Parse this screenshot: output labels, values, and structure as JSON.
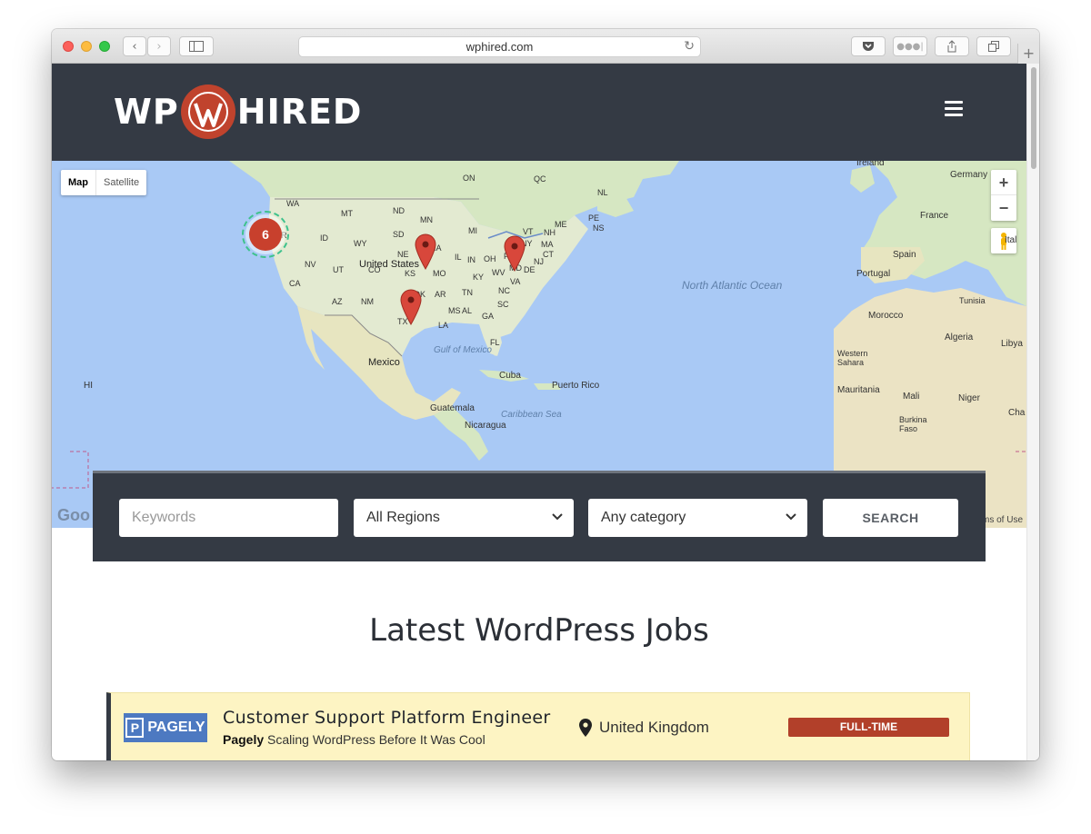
{
  "browser": {
    "url": "wphired.com"
  },
  "site": {
    "logo_left": "WP",
    "logo_right": "HIRED"
  },
  "map": {
    "type_map": "Map",
    "type_satellite": "Satellite",
    "zoom_in": "+",
    "zoom_out": "−",
    "cluster_count": "6",
    "google_mark": "Goo",
    "terms": "ms of Use",
    "labels": {
      "us": "United States",
      "mexico": "Mexico",
      "north_atlantic": "North Atlantic Ocean",
      "gulf": "Gulf of Mexico",
      "caribbean": "Caribbean Sea",
      "cuba": "Cuba",
      "puerto_rico": "Puerto Rico",
      "guatemala": "Guatemala",
      "nicaragua": "Nicaragua",
      "hi": "HI",
      "ireland": "Ireland",
      "germany": "Germany",
      "france": "France",
      "spain": "Spain",
      "portugal": "Portugal",
      "italy": "Ital",
      "morocco": "Morocco",
      "tunisia": "Tunisia",
      "algeria": "Algeria",
      "libya": "Libya",
      "western_sahara": "Western Sahara",
      "mauritania": "Mauritania",
      "mali": "Mali",
      "niger": "Niger",
      "burkina": "Burkina Faso",
      "chad": "Cha",
      "on": "ON",
      "qc": "QC",
      "nl": "NL",
      "pe": "PE",
      "ns": "NS",
      "wa": "WA",
      "mt": "MT",
      "nd": "ND",
      "mn": "MN",
      "mi": "MI",
      "me": "ME",
      "vt": "VT",
      "nh": "NH",
      "ny": "NY",
      "ma": "MA",
      "or": "OR",
      "id": "ID",
      "wy": "WY",
      "sd": "SD",
      "ia": "IA",
      "ne": "NE",
      "il": "IL",
      "in": "IN",
      "oh": "OH",
      "pa": "PA",
      "ct": "CT",
      "nj": "NJ",
      "nv": "NV",
      "ut": "UT",
      "co": "CO",
      "ks": "KS",
      "mo": "MO",
      "ky": "KY",
      "wv": "WV",
      "va": "VA",
      "de": "DE",
      "md": "MD",
      "ca": "CA",
      "az": "AZ",
      "nm": "NM",
      "ok": "OK",
      "ar": "AR",
      "tn": "TN",
      "nc": "NC",
      "ms": "MS",
      "al": "AL",
      "ga": "GA",
      "sc": "SC",
      "tx": "TX",
      "la": "LA",
      "fl": "FL"
    }
  },
  "search": {
    "keywords_placeholder": "Keywords",
    "region_value": "All Regions",
    "category_value": "Any category",
    "button_label": "SEARCH"
  },
  "jobs_section": {
    "title": "Latest WordPress Jobs",
    "jobs": [
      {
        "logo_text": "PAGELY",
        "title": "Customer Support Platform Engineer",
        "company": "Pagely",
        "tagline": "Scaling WordPress Before It Was Cool",
        "location": "United Kingdom",
        "type": "FULL-TIME"
      }
    ]
  },
  "colors": {
    "header_bg": "#343a44",
    "accent": "#c0432d",
    "badge": "#b2402a",
    "job_bg": "#fdf4c3",
    "map_water": "#a9c9f5"
  }
}
